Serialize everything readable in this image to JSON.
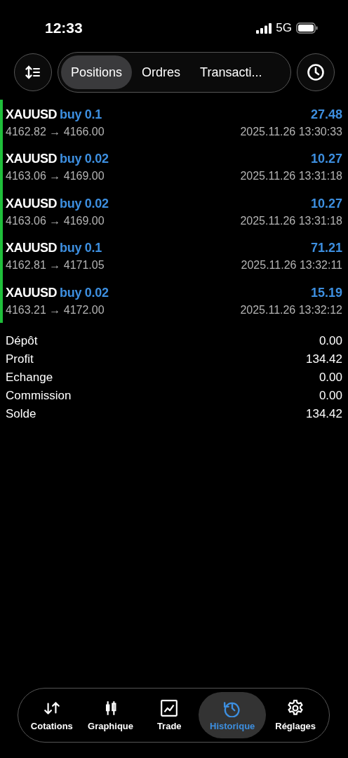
{
  "status_bar": {
    "time": "12:33",
    "network": "5G"
  },
  "tabs": [
    {
      "label": "Positions",
      "selected": true
    },
    {
      "label": "Ordres",
      "selected": false
    },
    {
      "label": "Transacti...",
      "selected": false
    }
  ],
  "deals": [
    {
      "symbol": "XAUUSD",
      "order": "buy 0.1",
      "profit": "27.48",
      "prices": "4162.82 → 4166.00",
      "time": "2025.11.26 13:30:33"
    },
    {
      "symbol": "XAUUSD",
      "order": "buy 0.02",
      "profit": "10.27",
      "prices": "4163.06 → 4169.00",
      "time": "2025.11.26 13:31:18"
    },
    {
      "symbol": "XAUUSD",
      "order": "buy 0.02",
      "profit": "10.27",
      "prices": "4163.06 → 4169.00",
      "time": "2025.11.26 13:31:18"
    },
    {
      "symbol": "XAUUSD",
      "order": "buy 0.1",
      "profit": "71.21",
      "prices": "4162.81 → 4171.05",
      "time": "2025.11.26 13:32:11"
    },
    {
      "symbol": "XAUUSD",
      "order": "buy 0.02",
      "profit": "15.19",
      "prices": "4163.21 → 4172.00",
      "time": "2025.11.26 13:32:12"
    }
  ],
  "summary": [
    {
      "label": "Dépôt",
      "value": "0.00"
    },
    {
      "label": "Profit",
      "value": "134.42"
    },
    {
      "label": "Echange",
      "value": "0.00"
    },
    {
      "label": "Commission",
      "value": "0.00"
    },
    {
      "label": "Solde",
      "value": "134.42"
    }
  ],
  "nav": [
    {
      "label": "Cotations",
      "kind": "quotes",
      "selected": false
    },
    {
      "label": "Graphique",
      "kind": "chart",
      "selected": false
    },
    {
      "label": "Trade",
      "kind": "trade",
      "selected": false
    },
    {
      "label": "Historique",
      "kind": "history",
      "selected": true
    },
    {
      "label": "Réglages",
      "kind": "settings",
      "selected": false
    }
  ]
}
